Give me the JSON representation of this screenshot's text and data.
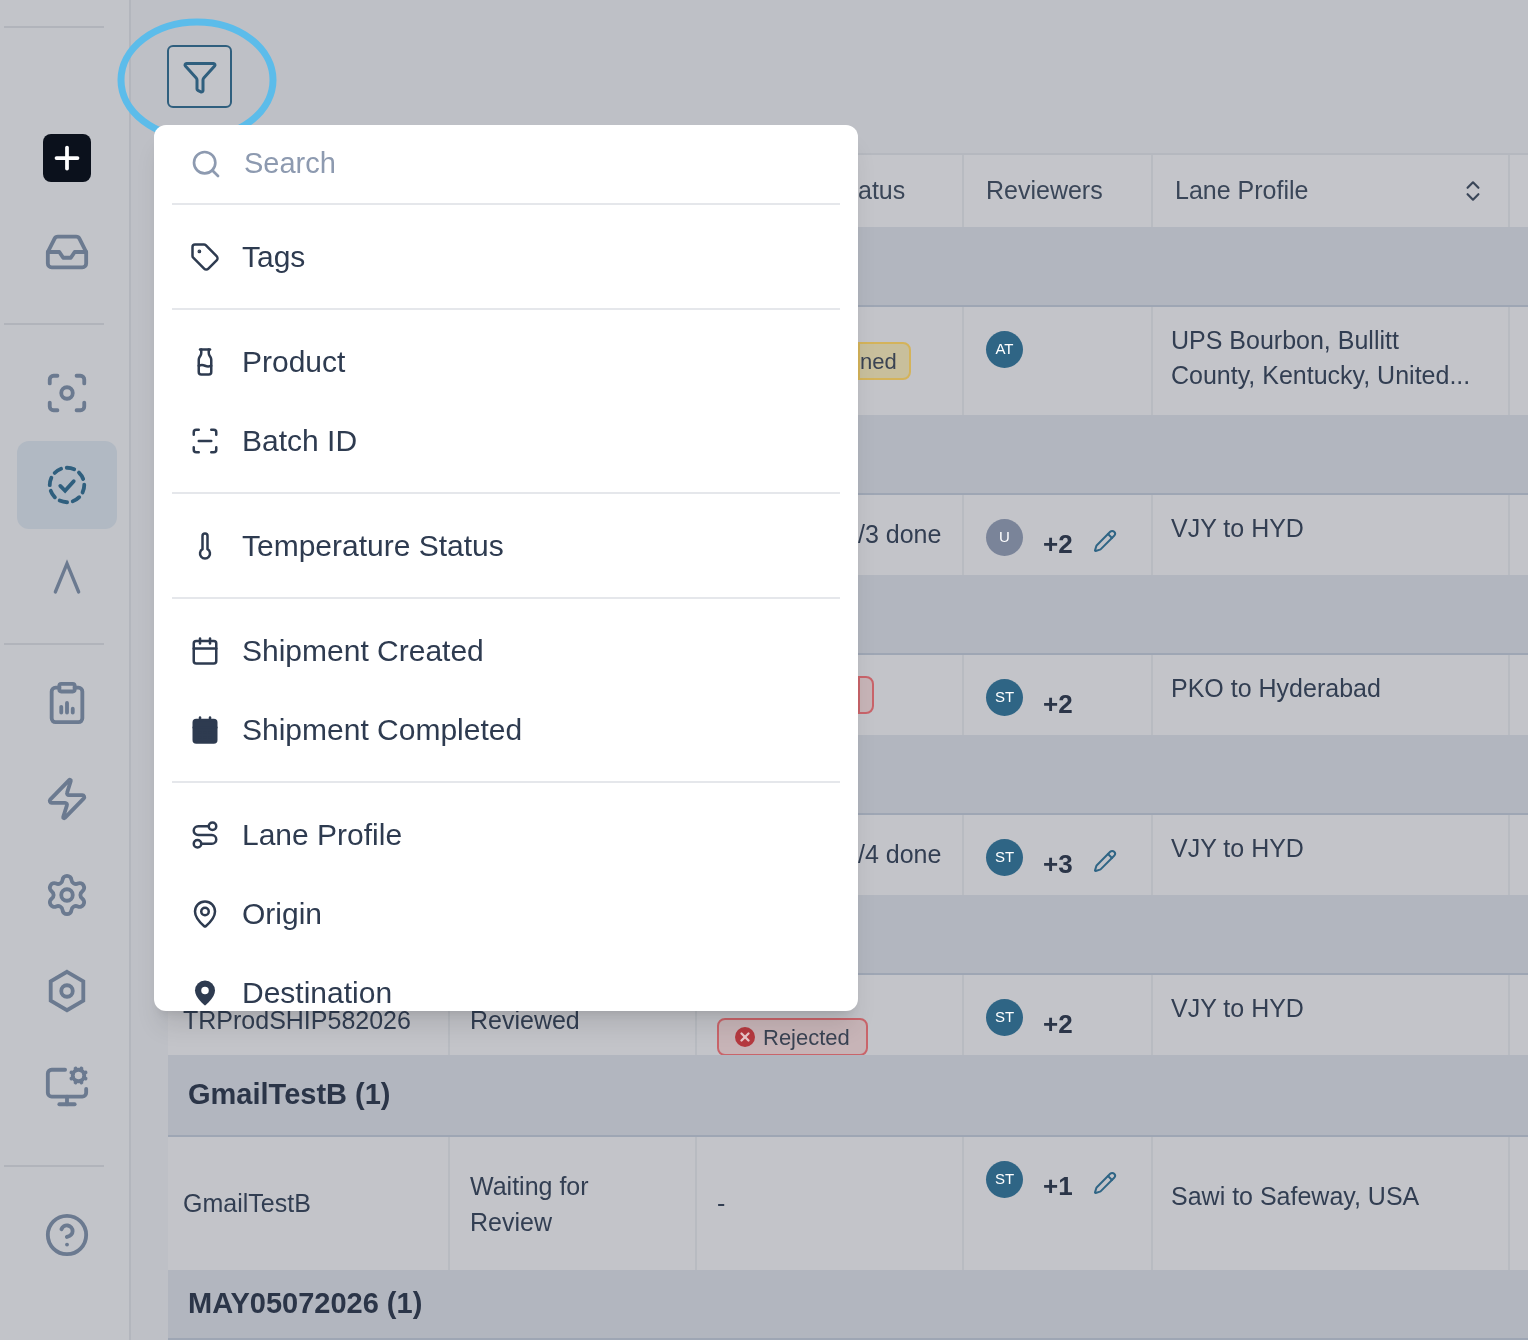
{
  "sidebar": {
    "items": [
      {
        "selected": false
      },
      {
        "selected": false
      },
      {
        "selected": false
      },
      {
        "selected": true
      },
      {
        "selected": false
      },
      {
        "selected": false
      },
      {
        "selected": false
      },
      {
        "selected": false
      },
      {
        "selected": false
      },
      {
        "selected": false
      },
      {
        "selected": false
      }
    ]
  },
  "filter_menu": {
    "search": {
      "placeholder": "Search"
    },
    "sections": [
      [
        "Tags"
      ],
      [
        "Product",
        "Batch ID"
      ],
      [
        "Temperature Status"
      ],
      [
        "Shipment Created",
        "Shipment Completed"
      ],
      [
        "Lane Profile",
        "Origin",
        "Destination"
      ]
    ]
  },
  "table": {
    "columns": [
      {
        "label": "atus",
        "sortable": false
      },
      {
        "label": "Reviewers",
        "sortable": false
      },
      {
        "label": "Lane Profile",
        "sortable": true
      }
    ],
    "rows": [
      {
        "kind": "group"
      },
      {
        "kind": "row",
        "status": {
          "kind": "warning_badge",
          "text": "ned"
        },
        "reviewer": {
          "initials": "AT",
          "color": "#2f6585",
          "editable": false
        },
        "lane_profile": "UPS Bourbon, Bullitt County, Kentucky, United..."
      },
      {
        "kind": "group"
      },
      {
        "kind": "row",
        "status": {
          "kind": "text",
          "text": "/3 done"
        },
        "reviewer": {
          "initials": "U",
          "color": "#7a8499",
          "extra": "+2",
          "editable": true
        },
        "lane_profile": "VJY to HYD"
      },
      {
        "kind": "group"
      },
      {
        "kind": "row",
        "status": {
          "kind": "danger_badge"
        },
        "reviewer": {
          "initials": "ST",
          "color": "#2f6585",
          "extra": "+2",
          "editable": false
        },
        "lane_profile": "PKO to Hyderabad"
      },
      {
        "kind": "group"
      },
      {
        "kind": "row",
        "status": {
          "kind": "text",
          "text": "/4 done"
        },
        "reviewer": {
          "initials": "ST",
          "color": "#2f6585",
          "extra": "+3",
          "editable": true
        },
        "lane_profile": "VJY to HYD"
      },
      {
        "kind": "group"
      },
      {
        "kind": "row",
        "id": "TRProdSHIP582026",
        "review_state": "Reviewed",
        "status": {
          "kind": "danger_badge",
          "icon": true,
          "text": "Rejected",
          "full": true
        },
        "reviewer": {
          "initials": "ST",
          "color": "#2f6585",
          "extra": "+2",
          "editable": false
        },
        "lane_profile": "VJY to HYD"
      },
      {
        "kind": "group",
        "label": "GmailTestB (1)"
      },
      {
        "kind": "row",
        "tall": true,
        "id": "GmailTestB",
        "review_state": "Waiting for Review",
        "status": {
          "kind": "text",
          "text": "-",
          "full": true
        },
        "reviewer": {
          "initials": "ST",
          "color": "#2f6585",
          "extra": "+1",
          "editable": true
        },
        "lane_profile": "Sawi to Safeway, USA"
      },
      {
        "kind": "group",
        "label": "MAY05072026 (1)"
      }
    ]
  }
}
